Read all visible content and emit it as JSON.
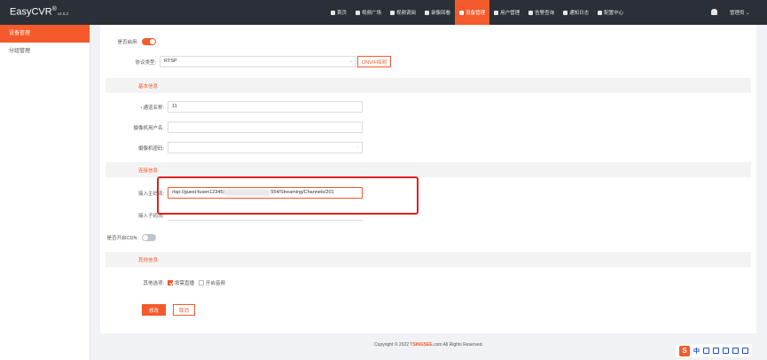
{
  "app": {
    "name": "EasyCVR",
    "mark": "®",
    "version": "v2.0.2"
  },
  "nav": [
    {
      "label": "首页",
      "icon": "home-icon"
    },
    {
      "label": "视频广场",
      "icon": "play-icon"
    },
    {
      "label": "视频调阅",
      "icon": "grid-icon"
    },
    {
      "label": "录像回看",
      "icon": "video-icon"
    },
    {
      "label": "设备管理",
      "icon": "device-icon",
      "active": true
    },
    {
      "label": "用户管理",
      "icon": "user-icon"
    },
    {
      "label": "告警查询",
      "icon": "alarm-icon"
    },
    {
      "label": "通知日志",
      "icon": "bell-icon"
    },
    {
      "label": "配置中心",
      "icon": "gear-icon"
    }
  ],
  "user": {
    "label": "管理员 ⌄"
  },
  "sidebar": {
    "items": [
      {
        "label": "设备管理"
      },
      {
        "label": "分组管理"
      }
    ]
  },
  "form": {
    "enabled_label": "是否启用:",
    "protocol_label": "协议类型:",
    "protocol_value": "RTSP",
    "onvif_button": "ONVIF探测",
    "section_basic": "基本信息",
    "channel_name_label": "通道名称:",
    "channel_name_value": "11",
    "cam_user_label": "摄像机用户名:",
    "cam_pass_label": "摄像机密码:",
    "section_conn": "连接信息",
    "main_stream_label": "接入主码流:",
    "main_stream_prefix": "rtsp://guest:fusen12345(",
    "main_stream_suffix": "554/Streaming/Channels/201",
    "sub_stream_label": "接入子码流:",
    "cdn_label": "是否开启CDN:",
    "section_other": "其他信息",
    "other_label": "其他选项:",
    "opt_on_demand": "按需直播",
    "opt_audio": "开启音频",
    "save_button": "修改",
    "cancel_button": "取消"
  },
  "footer": {
    "prefix": "Copyright © 2022 ",
    "brand": "TSINGSEE",
    "suffix": ".com All Rights Reserved."
  },
  "taskbar": {
    "s": "S",
    "zh": "中"
  },
  "colors": {
    "accent": "#f45a2b",
    "topbar": "#2b2f36"
  }
}
